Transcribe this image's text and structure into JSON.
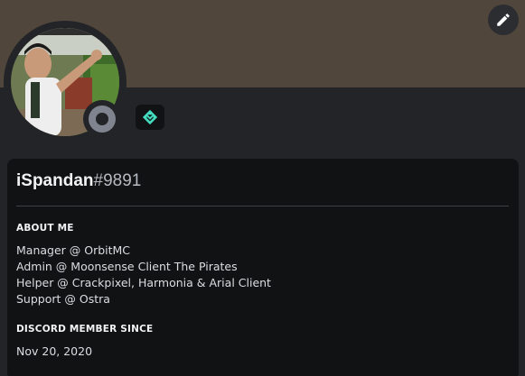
{
  "profile": {
    "username": "iSpandan",
    "discriminator": "#9891",
    "status": "offline",
    "status_color": "#80848e",
    "banner_color": "#50463b",
    "badge_icon": "hypesquad-balance-icon",
    "badge_color": "#45ddc0"
  },
  "actions": {
    "edit_icon": "pencil-icon"
  },
  "about": {
    "title": "ABOUT ME",
    "lines": [
      "Manager @ OrbitMC",
      "Admin @ Moonsense Client The Pirates",
      "Helper @ Crackpixel, Harmonia & Arial Client",
      "Support @ Ostra"
    ]
  },
  "member_since": {
    "title": "DISCORD MEMBER SINCE",
    "date": "Nov 20, 2020"
  }
}
